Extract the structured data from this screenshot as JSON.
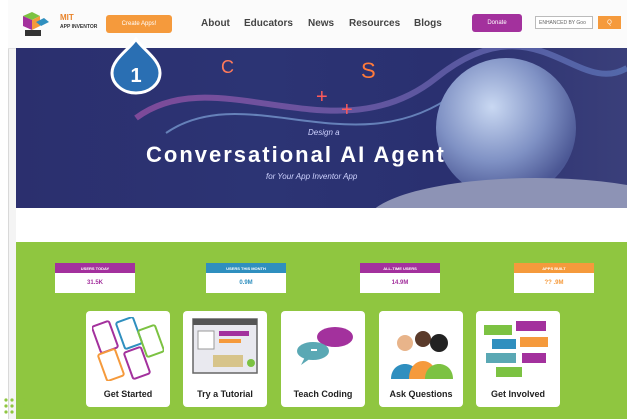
{
  "header": {
    "logo_line1": "MIT",
    "logo_line2": "APP INVENTOR",
    "create_label": "Create Apps!",
    "nav": [
      "About",
      "Educators",
      "News",
      "Resources",
      "Blogs"
    ],
    "donate_label": "Donate",
    "search_placeholder": "ENHANCED BY Goo",
    "search_button_label": "Q"
  },
  "hero": {
    "line1": "Design a",
    "title": "Conversational AI Agent",
    "line2": "for Your App Inventor App"
  },
  "callout": {
    "number": "1"
  },
  "stats": [
    {
      "label": "USERS TODAY",
      "value": "31.5K",
      "color": "#a3319d",
      "text_color": "#a3319d"
    },
    {
      "label": "USERS THIS MONTH",
      "value": "0.9M",
      "color": "#2f8fbf",
      "text_color": "#2f8fbf"
    },
    {
      "label": "ALL-TIME USERS",
      "value": "14.9M",
      "color": "#a3319d",
      "text_color": "#a3319d"
    },
    {
      "label": "APPS BUILT",
      "value": "?? .9M",
      "color": "#f59a3c",
      "text_color": "#f59a3c"
    }
  ],
  "cards": [
    {
      "label": "Get Started"
    },
    {
      "label": "Try a Tutorial"
    },
    {
      "label": "Teach Coding"
    },
    {
      "label": "Ask Questions"
    },
    {
      "label": "Get Involved"
    }
  ],
  "colors": {
    "accent_orange": "#f59a3c",
    "purple": "#a3319d",
    "green": "#8fc640",
    "hero_blue": "#2b2f6e",
    "callout_blue": "#2a6fb3"
  }
}
